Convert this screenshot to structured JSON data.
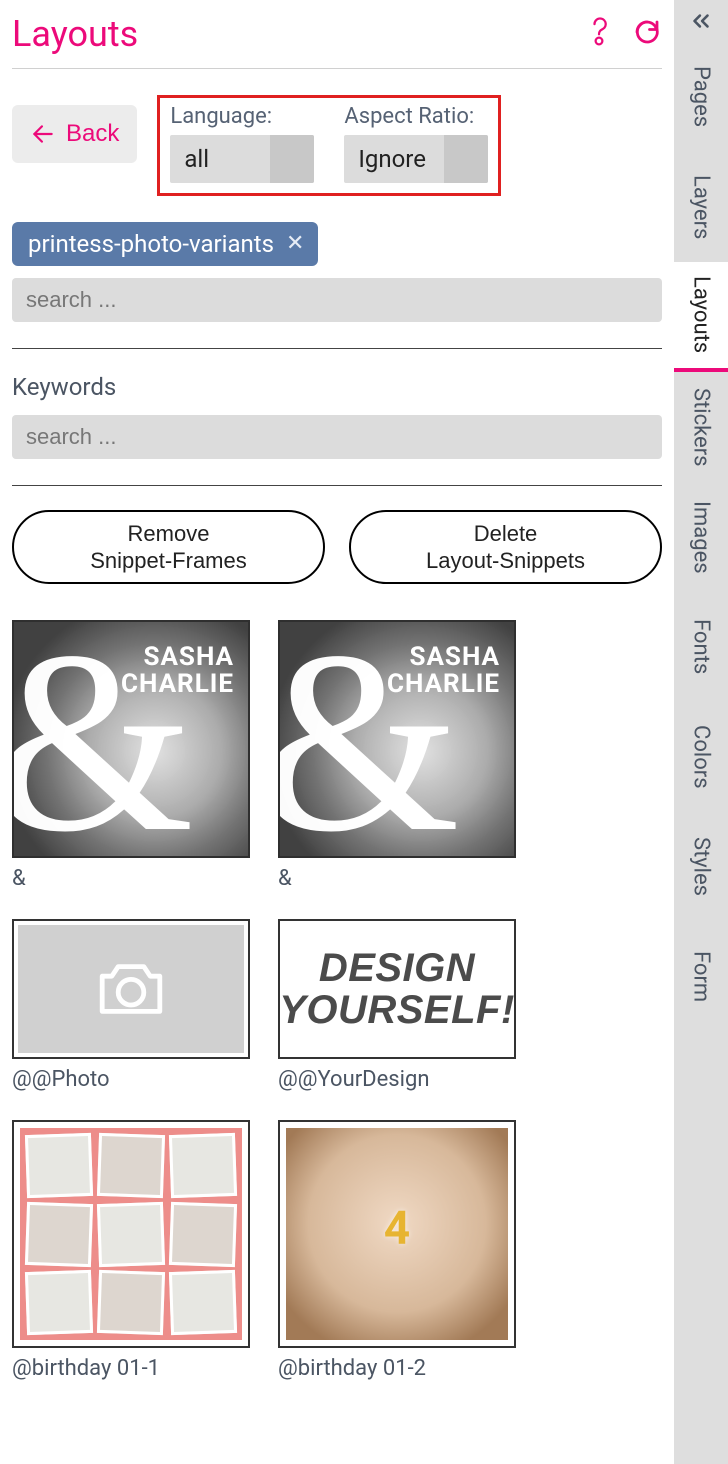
{
  "accent": "#ec0a7a",
  "header": {
    "title": "Layouts"
  },
  "back_label": "Back",
  "filters": {
    "language": {
      "label": "Language:",
      "value": "all"
    },
    "aspect": {
      "label": "Aspect Ratio:",
      "value": "Ignore"
    }
  },
  "tag": "printess-photo-variants",
  "search_placeholder": "search ...",
  "keywords_label": "Keywords",
  "keywords_search_placeholder": "search ...",
  "buttons": {
    "remove_line1": "Remove",
    "remove_line2": "Snippet-Frames",
    "delete_line1": "Delete",
    "delete_line2": "Layout-Snippets"
  },
  "thumb_text": {
    "name1": "SASHA",
    "and": "&",
    "name2": "CHARLIE",
    "design_line1": "DESIGN",
    "design_line2": "YOURSELF!",
    "candle": "4"
  },
  "items": [
    {
      "label": "&"
    },
    {
      "label": "&"
    },
    {
      "label": "@@Photo"
    },
    {
      "label": "@@YourDesign"
    },
    {
      "label": "@birthday 01-1"
    },
    {
      "label": "@birthday 01-2"
    }
  ],
  "rail": {
    "tabs": [
      "Pages",
      "Layers",
      "Layouts",
      "Stickers",
      "Images",
      "Fonts",
      "Colors",
      "Styles",
      "Form"
    ],
    "active": "Layouts"
  }
}
